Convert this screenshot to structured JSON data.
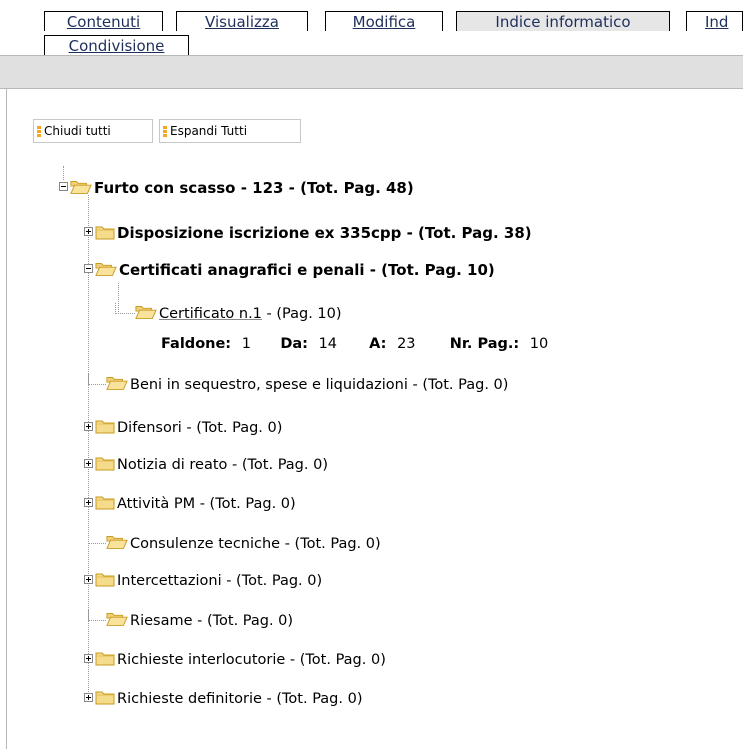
{
  "tabs": [
    {
      "label": "Contenuti",
      "active": false
    },
    {
      "label": "Visualizza",
      "active": false
    },
    {
      "label": "Modifica",
      "active": false
    },
    {
      "label": "Indice informatico",
      "active": true
    },
    {
      "label": "Ind",
      "active": false
    },
    {
      "label": "Condivisione",
      "active": false
    }
  ],
  "toolbar": {
    "collapse_all": "Chiudi tutti",
    "expand_all": "Espandi Tutti"
  },
  "tree": {
    "root": "Furto con scasso - 123 - (Tot. Pag. 48)",
    "items": [
      {
        "label": "Disposizione iscrizione ex 335cpp - (Tot. Pag. 38)",
        "state": "collapsed",
        "bold": true
      },
      {
        "label": "Certificati anagrafici e penali - (Tot. Pag. 10)",
        "state": "expanded",
        "bold": true
      },
      {
        "label": "Beni in sequestro, spese e liquidazioni - (Tot. Pag. 0)",
        "state": "leaf"
      },
      {
        "label": "Difensori - (Tot. Pag. 0)",
        "state": "collapsed"
      },
      {
        "label": "Notizia di reato - (Tot. Pag. 0)",
        "state": "collapsed"
      },
      {
        "label": "Attività PM - (Tot. Pag. 0)",
        "state": "collapsed"
      },
      {
        "label": "Consulenze tecniche - (Tot. Pag. 0)",
        "state": "leaf"
      },
      {
        "label": "Intercettazioni - (Tot. Pag. 0)",
        "state": "collapsed"
      },
      {
        "label": "Riesame - (Tot. Pag. 0)",
        "state": "leaf"
      },
      {
        "label": "Richieste interlocutorie - (Tot. Pag. 0)",
        "state": "collapsed"
      },
      {
        "label": "Richieste definitorie - (Tot. Pag. 0)",
        "state": "collapsed"
      }
    ],
    "document": {
      "link": "Certificato n.1",
      "pages": " - (Pag. 10)",
      "faldone_label": "Faldone:",
      "faldone": "1",
      "da_label": "Da:",
      "da": "14",
      "a_label": "A:",
      "a": "23",
      "nr_label": "Nr. Pag.:",
      "nr": "10"
    }
  },
  "colors": {
    "folder_fill": "#f5dc8c",
    "folder_stroke": "#c89a1e",
    "button_accent": "#f5a623",
    "bar_gray": "#e0e0e0"
  }
}
